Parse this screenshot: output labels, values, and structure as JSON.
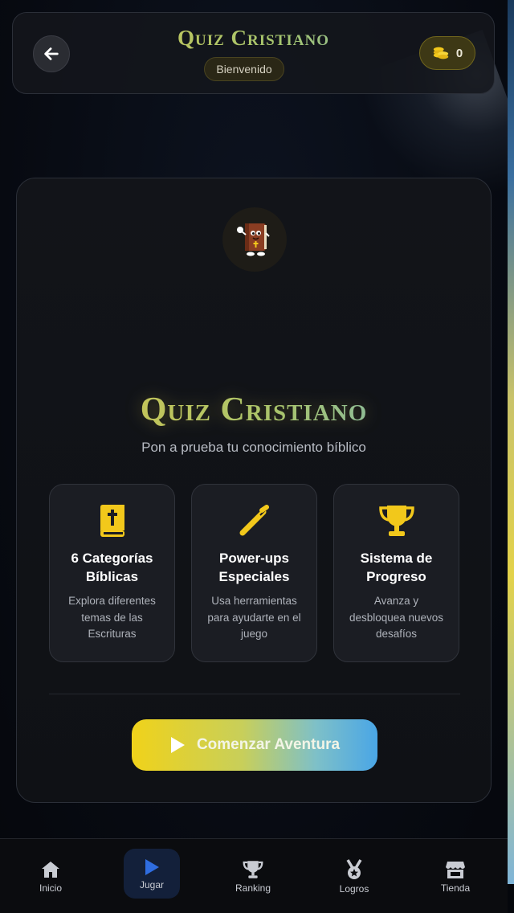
{
  "header": {
    "title": "Quiz Cristiano",
    "welcome_badge": "Bienvenido",
    "coins": "0"
  },
  "card": {
    "title": "Quiz Cristiano",
    "subtitle": "Pon a prueba tu conocimiento bíblico",
    "features": [
      {
        "title": "6 Categorías Bíblicas",
        "description": "Explora diferentes temas de las Escrituras",
        "icon": "bible-icon"
      },
      {
        "title": "Power-ups Especiales",
        "description": "Usa herramientas para ayudarte en el juego",
        "icon": "magic-wand-icon"
      },
      {
        "title": "Sistema de Progreso",
        "description": "Avanza y desbloquea nuevos desafíos",
        "icon": "trophy-icon"
      }
    ],
    "cta_label": "Comenzar Aventura"
  },
  "nav": {
    "items": [
      {
        "label": "Inicio",
        "icon": "home-icon"
      },
      {
        "label": "Jugar",
        "icon": "play-icon",
        "active": true
      },
      {
        "label": "Ranking",
        "icon": "trophy-icon"
      },
      {
        "label": "Logros",
        "icon": "medal-icon"
      },
      {
        "label": "Tienda",
        "icon": "store-icon"
      }
    ]
  },
  "colors": {
    "accent_gold": "#f2c81b",
    "accent_blue": "#4aa6e6",
    "active_nav": "#2f6de0"
  }
}
